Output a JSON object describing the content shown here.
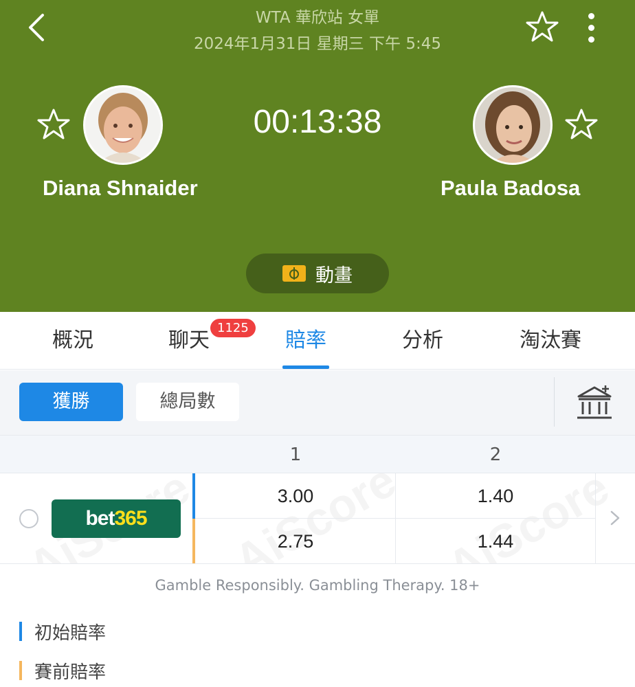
{
  "header": {
    "league": "WTA 華欣站 女單",
    "datetime": "2024年1月31日 星期三 下午 5:45",
    "timer": "00:13:38",
    "animation_label": "動畫",
    "bg_color": "#5f8321"
  },
  "players": {
    "home": {
      "name": "Diana Shnaider"
    },
    "away": {
      "name": "Paula Badosa"
    }
  },
  "tabs": [
    {
      "label": "概況",
      "active": false
    },
    {
      "label": "聊天",
      "active": false,
      "badge": "1125"
    },
    {
      "label": "賠率",
      "active": true
    },
    {
      "label": "分析",
      "active": false
    },
    {
      "label": "淘汰賽",
      "active": false
    }
  ],
  "subtabs": [
    {
      "label": "獲勝",
      "active": true
    },
    {
      "label": "總局數",
      "active": false
    }
  ],
  "odds": {
    "columns": [
      "1",
      "2"
    ],
    "bookmaker": {
      "name_part1": "bet",
      "name_part2": "365"
    },
    "opening": [
      "3.00",
      "1.40"
    ],
    "pre_match": [
      "2.75",
      "1.44"
    ],
    "watermark": "AiScore"
  },
  "footer": {
    "disclaimer": "Gamble Responsibly. Gambling Therapy. 18+",
    "legend": [
      {
        "label": "初始賠率",
        "color": "#1e88e5"
      },
      {
        "label": "賽前賠率",
        "color": "#f5b75e"
      }
    ]
  },
  "accent_color": "#1e88e5"
}
